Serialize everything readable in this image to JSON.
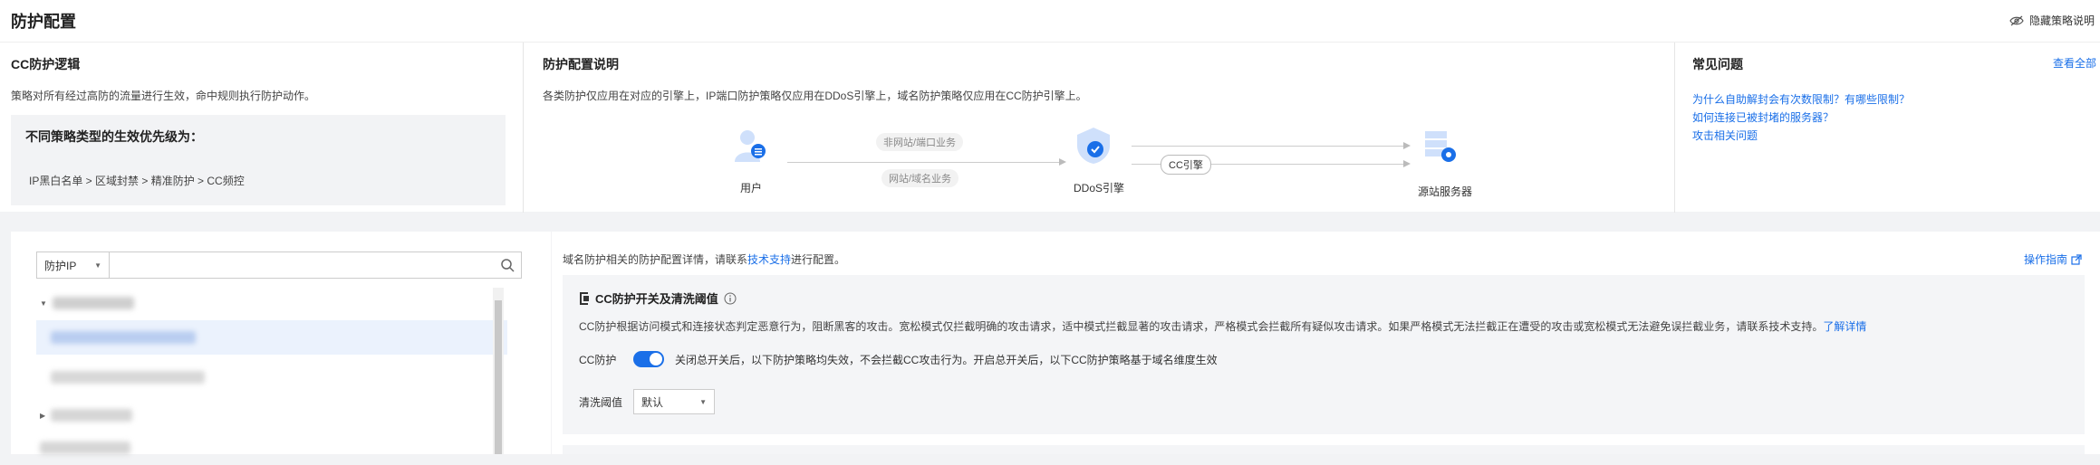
{
  "header": {
    "title": "防护配置",
    "hide_toggle_label": "隐藏策略说明"
  },
  "cc_logic": {
    "title": "CC防护逻辑",
    "desc": "策略对所有经过高防的流量进行生效，命中规则执行防护动作。",
    "priority_title": "不同策略类型的生效优先级为：",
    "priority_text": "IP黑白名单 > 区域封禁 > 精准防护 > CC频控"
  },
  "config_desc": {
    "title": "防护配置说明",
    "desc": "各类防护仅应用在对应的引擎上，IP端口防护策略仅应用在DDoS引擎上，域名防护策略仅应用在CC防护引擎上。",
    "flow": {
      "user_label": "用户",
      "tag_non_web": "非网站/端口业务",
      "tag_web": "网站/域名业务",
      "ddos_label": "DDoS引擎",
      "cc_tag": "CC引擎",
      "origin_label": "源站服务器"
    }
  },
  "faq": {
    "title": "常见问题",
    "view_all": "查看全部",
    "links": [
      "为什么自助解封会有次数限制？有哪些限制？",
      "如何连接已被封堵的服务器？",
      "攻击相关问题"
    ]
  },
  "tree": {
    "search_type": "防护IP",
    "search_placeholder": ""
  },
  "content": {
    "intro_prefix": "域名防护相关的防护配置详情，请联系",
    "intro_link": "技术支持",
    "intro_suffix": "进行配置。",
    "guide_link": "操作指南",
    "card_title": "CC防护开关及清洗阈值",
    "card_desc": "CC防护根据访问模式和连接状态判定恶意行为，阻断黑客的攻击。宽松模式仅拦截明确的攻击请求，适中模式拦截显著的攻击请求，严格模式会拦截所有疑似攻击请求。如果严格模式无法拦截正在遭受的攻击或宽松模式无法避免误拦截业务，请联系技术支持。",
    "card_desc_link": "了解详情",
    "cc_switch_label": "CC防护",
    "cc_switch_on": true,
    "cc_switch_note": "关闭总开关后，以下防护策略均失效，不会拦截CC攻击行为。开启总开关后，以下CC防护策略基于域名维度生效",
    "threshold_label": "清洗阈值",
    "threshold_value": "默认"
  },
  "colors": {
    "accent": "#1a6fe8",
    "card_bg": "#f4f5f7"
  }
}
